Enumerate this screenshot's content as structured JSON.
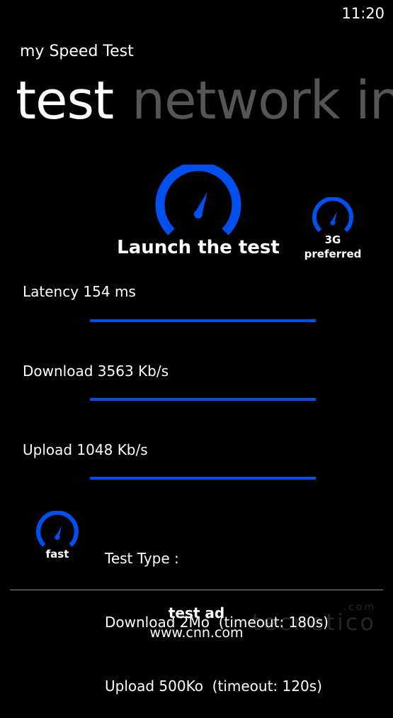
{
  "status_bar": {
    "time": "11:20"
  },
  "app": {
    "title": "my Speed Test",
    "pivot": [
      "test",
      "network in"
    ]
  },
  "launch": {
    "label": "Launch the test",
    "icon": "speedometer-icon"
  },
  "network_pref": {
    "line1": "3G",
    "line2": "preferred",
    "icon": "speedometer-icon"
  },
  "metrics": {
    "latency": "Latency 154 ms",
    "download": "Download 3563 Kb/s",
    "upload": "Upload 1048 Kb/s"
  },
  "speed_mode": {
    "label": "fast",
    "icon": "speedometer-icon"
  },
  "test_type": {
    "heading": "Test Type :",
    "download": "Download 2Mo  (timeout: 180s)",
    "upload": "Upload 500Ko  (timeout: 120s)"
  },
  "ad": {
    "title": "test ad",
    "url": "www.cnn.com"
  },
  "watermark": {
    "text": "tecnetico",
    "suffix": ".com"
  },
  "colors": {
    "accent": "#0050ef",
    "background": "#000000",
    "inactive_pivot": "#555555"
  }
}
